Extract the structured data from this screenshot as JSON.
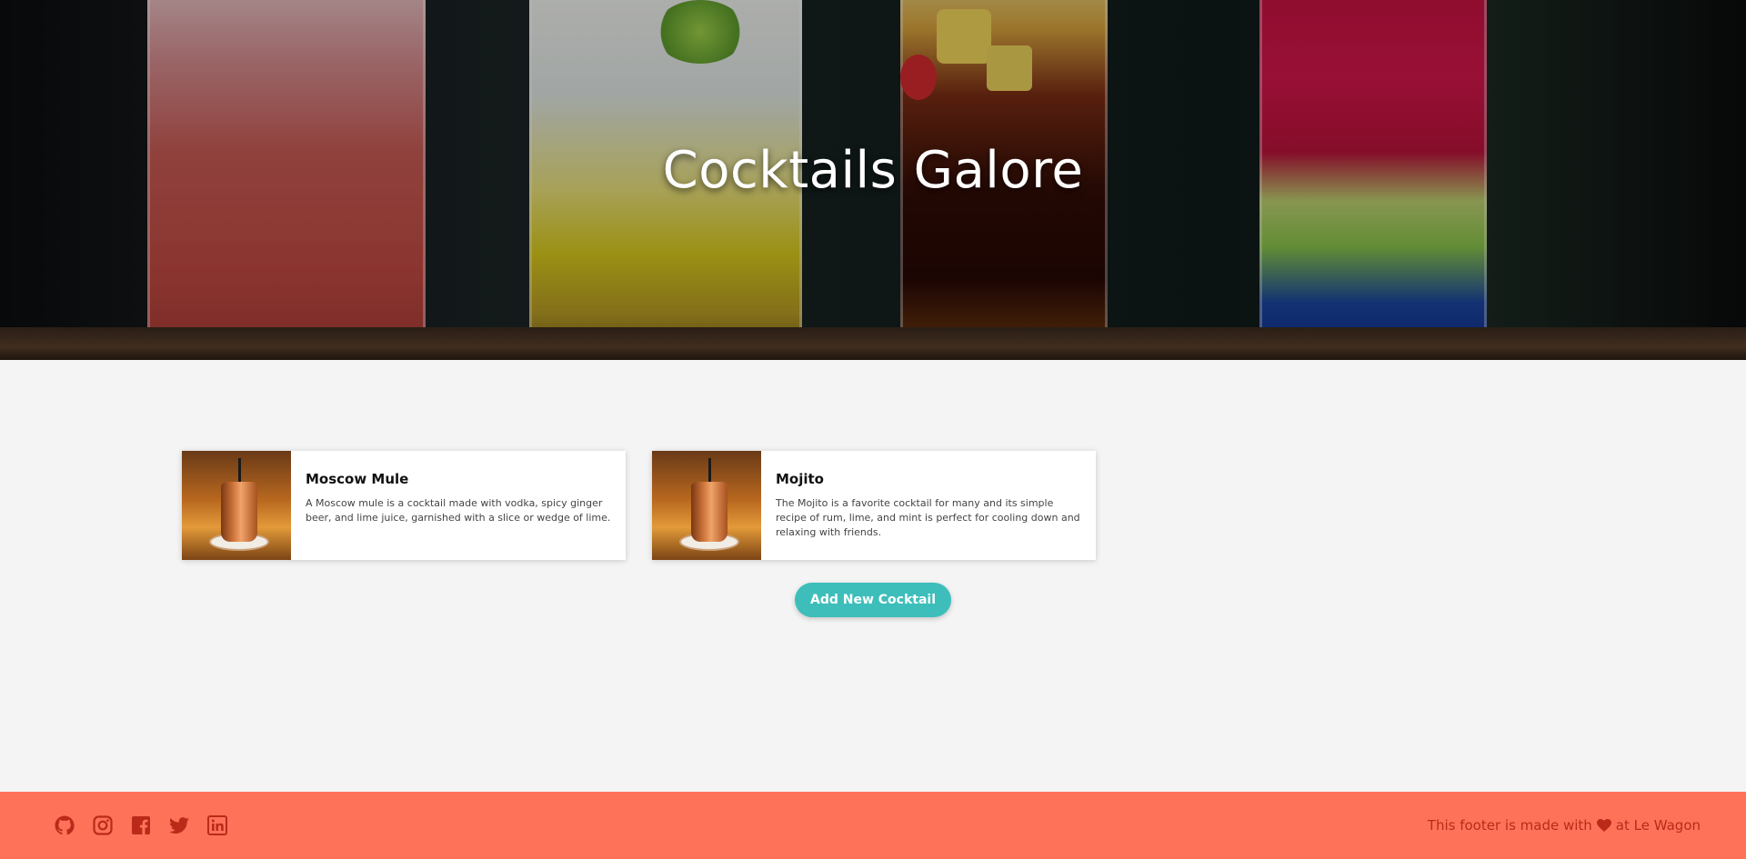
{
  "hero": {
    "title": "Cocktails Galore"
  },
  "cocktails": [
    {
      "name": "Moscow Mule",
      "description": "A Moscow mule is a cocktail made with vodka, spicy ginger beer, and lime juice, garnished with a slice or wedge of lime."
    },
    {
      "name": "Mojito",
      "description": "The Mojito is a favorite cocktail for many and its simple recipe of rum, lime, and mint is perfect for cooling down and relaxing with friends."
    }
  ],
  "actions": {
    "add_label": "Add New Cocktail"
  },
  "footer": {
    "icons": [
      "github-icon",
      "instagram-icon",
      "facebook-icon",
      "twitter-icon",
      "linkedin-icon"
    ],
    "text_before": "This footer is made with",
    "text_after": "at Le Wagon"
  },
  "colors": {
    "accent": "#3dbebb",
    "footer_bg": "#fe725a",
    "footer_fg": "#bb2a18",
    "page_bg": "#f4f4f4"
  }
}
